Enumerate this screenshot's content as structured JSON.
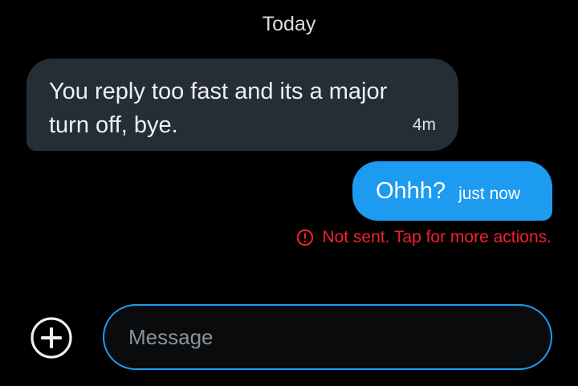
{
  "conversation": {
    "date_header": "Today",
    "messages": [
      {
        "direction": "incoming",
        "text": "You reply too fast and its a major turn off, bye.",
        "time": "4m"
      },
      {
        "direction": "outgoing",
        "text": "Ohhh?",
        "time": "just now",
        "status": "Not sent. Tap for more actions.",
        "status_icon": "alert-circle-icon"
      }
    ]
  },
  "composer": {
    "add_icon": "plus-circle-icon",
    "placeholder": "Message",
    "value": ""
  },
  "colors": {
    "background": "#000000",
    "incoming_bubble": "#252d35",
    "outgoing_bubble": "#1d9bf0",
    "error": "#f4212e",
    "accent": "#1d9bf0"
  }
}
